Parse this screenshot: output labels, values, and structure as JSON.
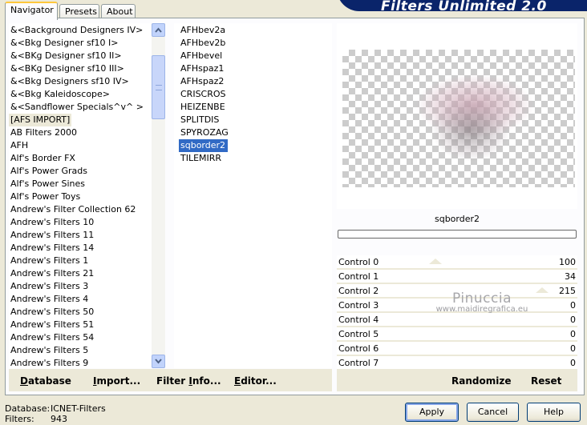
{
  "window": {
    "title": "Filters Unlimited 2.0"
  },
  "tabs": [
    {
      "label": "Navigator",
      "active": true
    },
    {
      "label": "Presets",
      "active": false
    },
    {
      "label": "About",
      "active": false
    }
  ],
  "categories": [
    "&<Background Designers IV>",
    "&<Bkg Designer sf10 I>",
    "&<BKg Designer sf10 II>",
    "&<BKg Designer sf10 III>",
    "&<Bkg Designers sf10 IV>",
    "&<Bkg Kaleidoscope>",
    "&<Sandflower Specials^v^ >",
    "[AFS IMPORT]",
    "AB Filters 2000",
    "AFH",
    "Alf's Border FX",
    "Alf's Power Grads",
    "Alf's Power Sines",
    "Alf's Power Toys",
    "Andrew's Filter Collection 62",
    "Andrew's Filters 10",
    "Andrew's Filters 11",
    "Andrew's Filters 14",
    "Andrew's Filters 1",
    "Andrew's Filters 21",
    "Andrew's Filters 3",
    "Andrew's Filters 4",
    "Andrew's Filters 50",
    "Andrew's Filters 51",
    "Andrew's Filters 54",
    "Andrew's Filters 5",
    "Andrew's Filters 9"
  ],
  "selected_category": "[AFS IMPORT]",
  "filters": [
    "AFHbev2a",
    "AFHbev2b",
    "AFHbevel",
    "AFHspaz1",
    "AFHspaz2",
    "CRISCROS",
    "HEIZENBE",
    "SPLITDIS",
    "SPYROZAG",
    "sqborder2",
    "TILEMIRR"
  ],
  "selected_filter": "sqborder2",
  "preview": {
    "filter_name": "sqborder2"
  },
  "controls": [
    {
      "name": "Control 0",
      "value": "100"
    },
    {
      "name": "Control 1",
      "value": "34"
    },
    {
      "name": "Control 2",
      "value": "215"
    },
    {
      "name": "Control 3",
      "value": "0"
    },
    {
      "name": "Control 4",
      "value": "0"
    },
    {
      "name": "Control 5",
      "value": "0"
    },
    {
      "name": "Control 6",
      "value": "0"
    },
    {
      "name": "Control 7",
      "value": "0"
    }
  ],
  "watermark": {
    "name": "Pinuccia",
    "site": "www.maidiregrafica.eu"
  },
  "left_buttons": [
    {
      "key": "D",
      "rest": "atabase"
    },
    {
      "key": "I",
      "rest": "mport..."
    },
    {
      "pre": "Filter ",
      "key": "I",
      "rest": "nfo..."
    },
    {
      "key": "E",
      "rest": "ditor..."
    }
  ],
  "right_buttons": {
    "randomize": "Randomize",
    "reset": "Reset"
  },
  "status": {
    "database_label": "Database:",
    "database_value": "ICNET-Filters",
    "filters_label": "Filters:",
    "filters_value": "943"
  },
  "dialog_buttons": {
    "apply": "Apply",
    "cancel": "Cancel",
    "help": "Help"
  }
}
